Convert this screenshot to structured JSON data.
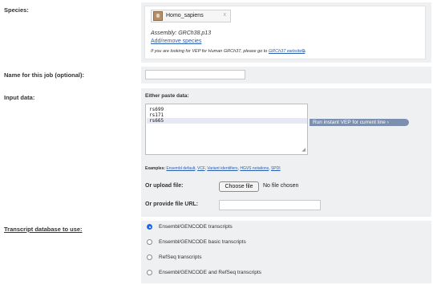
{
  "species": {
    "label": "Species:",
    "chip_name": "Homo_sapiens",
    "chip_remove": "x",
    "assembly": "Assembly: GRCh38.p13",
    "add_remove_link": "Add/remove species",
    "grch37_note_prefix": "If you are looking for VEP for Human GRCh37, please go to ",
    "grch37_link": "GRCh37 website",
    "grch37_note_suffix": "."
  },
  "job_name": {
    "label": "Name for this job (optional):",
    "value": ""
  },
  "input_data": {
    "label": "Input data:",
    "either_label": "Either paste data:",
    "paste_lines": [
      "rs699",
      "rs171",
      "rs665"
    ],
    "instant_button": "Run instant VEP for current line ›",
    "examples_label": "Examples:",
    "examples": [
      "Ensembl default",
      "VCF",
      "Variant identifiers",
      "HGVS notations",
      "SPDI"
    ],
    "upload_label": "Or upload file:",
    "choose_file_button": "Choose file",
    "no_file_text": "No file chosen",
    "url_label": "Or provide file URL:",
    "url_value": ""
  },
  "transcript_db": {
    "label": "Transcript database to use:",
    "options": [
      {
        "label": "Ensembl/GENCODE transcripts",
        "checked": true
      },
      {
        "label": "Ensembl/GENCODE basic transcripts",
        "checked": false
      },
      {
        "label": "RefSeq transcripts",
        "checked": false
      },
      {
        "label": "Ensembl/GENCODE and RefSeq transcripts",
        "checked": false
      }
    ]
  },
  "colors": {
    "panel_bg": "#eff0f1",
    "link": "#2a5db0",
    "radio_checked": "#1a6ae8",
    "instant_button_bg": "#7d8fae"
  }
}
